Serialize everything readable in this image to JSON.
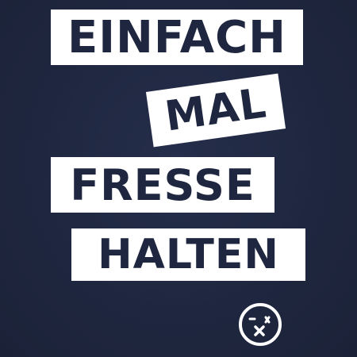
{
  "lines": {
    "line1": "EINFACH",
    "line2": "MAL",
    "line3": "FRESSE",
    "line4": "HALTEN"
  },
  "logo_icon": "smiley-face-x-mouth-icon",
  "colors": {
    "background": "#1f2740",
    "block": "#ffffff",
    "text": "#1f2740"
  }
}
